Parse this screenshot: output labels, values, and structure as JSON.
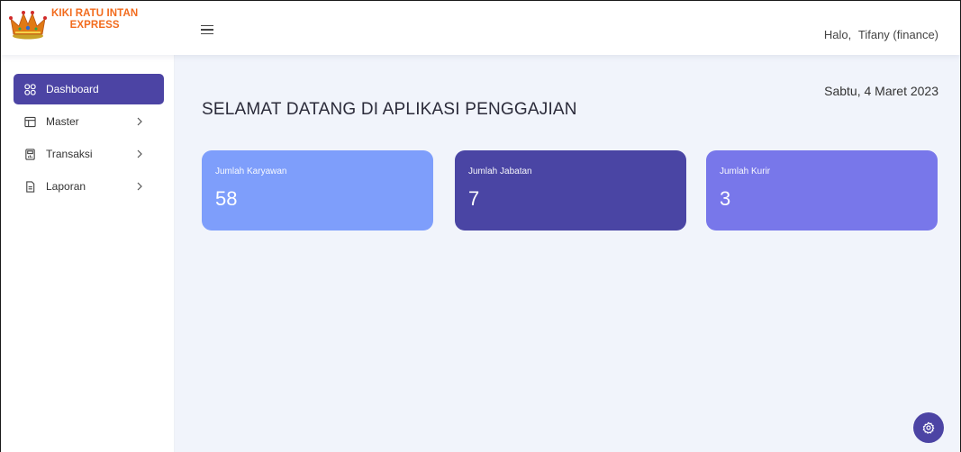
{
  "brand": {
    "line1": "KIKI RATU INTAN",
    "line2": "EXPRESS",
    "color": "#f26b1d",
    "logo_icon": "crown-icon"
  },
  "header": {
    "menu_icon": "hamburger-menu-icon",
    "greeting": "Halo,",
    "user": "Tifany (finance)"
  },
  "sidebar": {
    "items": [
      {
        "label": "Dashboard",
        "icon": "grid-icon",
        "active": true
      },
      {
        "label": "Master",
        "icon": "table-icon",
        "has_submenu": true
      },
      {
        "label": "Transaksi",
        "icon": "calculator-icon",
        "has_submenu": true
      },
      {
        "label": "Laporan",
        "icon": "document-icon",
        "has_submenu": true
      }
    ],
    "active_color": "#4c44a4"
  },
  "main": {
    "date": "Sabtu, 4 Maret 2023",
    "title": "SELAMAT DATANG DI APLIKASI PENGGAJIAN",
    "cards": [
      {
        "label": "Jumlah Karyawan",
        "value": "58",
        "color": "#7e9efb"
      },
      {
        "label": "Jumlah Jabatan",
        "value": "7",
        "color": "#4a45a4"
      },
      {
        "label": "Jumlah Kurir",
        "value": "3",
        "color": "#7877ea"
      }
    ],
    "settings_icon": "gear-icon"
  }
}
